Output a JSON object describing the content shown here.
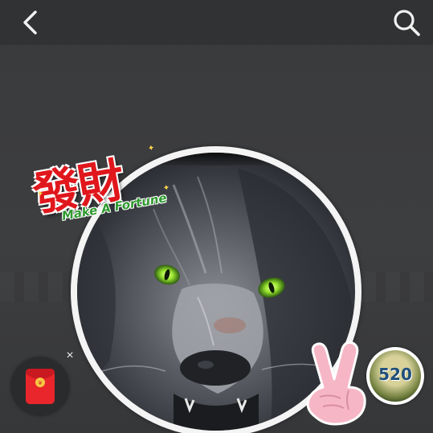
{
  "topbar": {
    "back_icon": "chevron-left-icon",
    "search_icon": "search-icon"
  },
  "sticker": {
    "chinese_text": "發財",
    "english_text": "Make A Fortune"
  },
  "avatar": {
    "description_icon": "wolf-avatar-image"
  },
  "red_packet": {
    "icon": "red-envelope-icon",
    "close_label": "×"
  },
  "badge": {
    "text": "520"
  },
  "colors": {
    "background": "#3a3b3d",
    "topbar": "#313234",
    "sticker_red": "#e0171c",
    "sticker_green": "#2f9a2f",
    "wolf_eye": "#9be830"
  }
}
